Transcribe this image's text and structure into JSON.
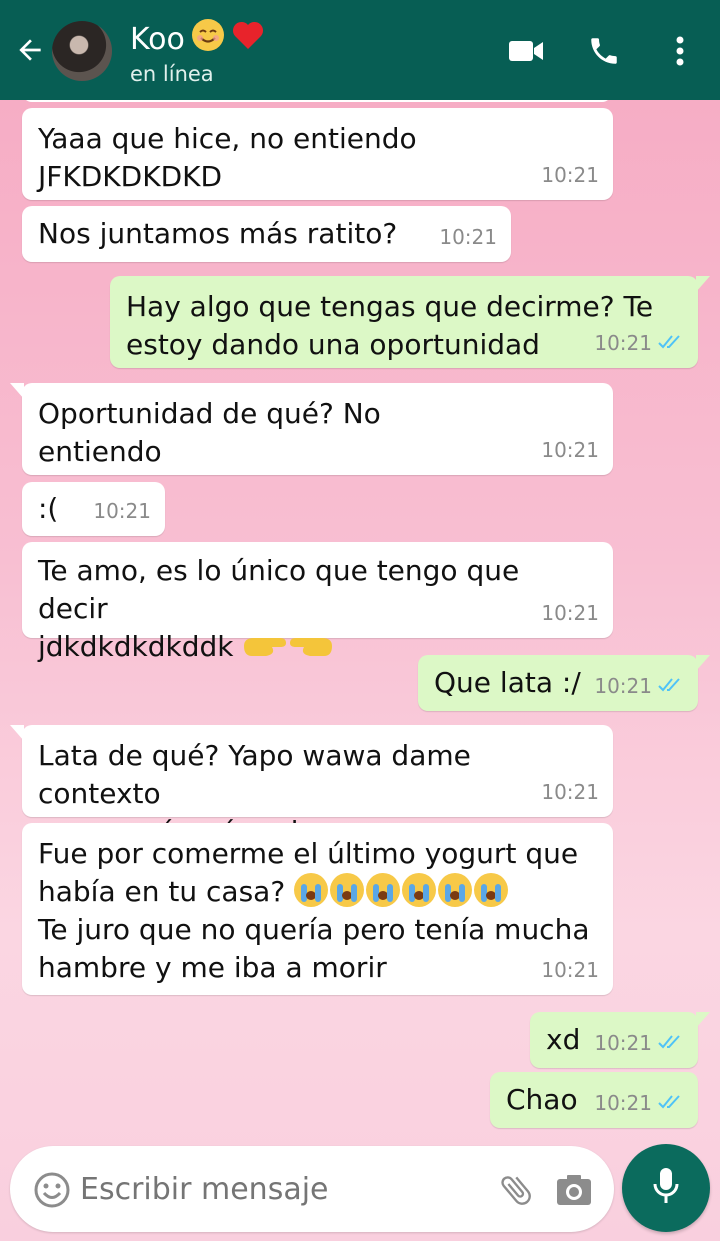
{
  "header": {
    "contact_name": "Koo",
    "name_emojis": [
      "smiling-face-icon",
      "red-heart-icon"
    ],
    "status": "en línea",
    "colors": {
      "bar": "#075e54"
    }
  },
  "messages": [
    {
      "side": "in",
      "text": "Yaaa que hice, no entiendo\nJFKDKDKDKD",
      "time": "10:21"
    },
    {
      "side": "in",
      "text": "Nos juntamos más ratito?",
      "time": "10:21"
    },
    {
      "side": "out",
      "text": "Hay algo que tengas que decirme? Te\nestoy dando una oportunidad",
      "time": "10:21",
      "read": true
    },
    {
      "side": "in",
      "text": "Oportunidad de qué? No\nentiendo",
      "time": "10:21"
    },
    {
      "side": "in",
      "text": ":(",
      "time": "10:21"
    },
    {
      "side": "in",
      "text": "Te amo, es lo único que tengo que decir\njdkdkdkdkddk",
      "time": "10:21",
      "emojis": [
        "pointing-right-icon",
        "pointing-left-icon"
      ]
    },
    {
      "side": "out",
      "text": "Que lata :/",
      "time": "10:21",
      "read": true
    },
    {
      "side": "in",
      "text": "Lata de qué? Yapo wawa dame contexto\nque no sé qué onda",
      "time": "10:21"
    },
    {
      "side": "in",
      "text_line1": "Fue por comerme el último yogurt que",
      "text_line2": "había en tu casa?",
      "text_rest": "Te juro que no quería pero tenía mucha\nhambre y me iba a morir",
      "time": "10:21",
      "emojis": [
        "crying-face-icon",
        "crying-face-icon",
        "crying-face-icon",
        "crying-face-icon",
        "crying-face-icon",
        "crying-face-icon"
      ]
    },
    {
      "side": "out",
      "text": "xd",
      "time": "10:21",
      "read": true
    },
    {
      "side": "out",
      "text": "Chao",
      "time": "10:21",
      "read": true
    }
  ],
  "composer": {
    "placeholder": "Escribir mensaje"
  },
  "colors": {
    "incoming_bubble": "#ffffff",
    "outgoing_bubble": "#dcf8c6",
    "read_ticks": "#4fc3f7",
    "mic_button": "#0b6b5d"
  }
}
